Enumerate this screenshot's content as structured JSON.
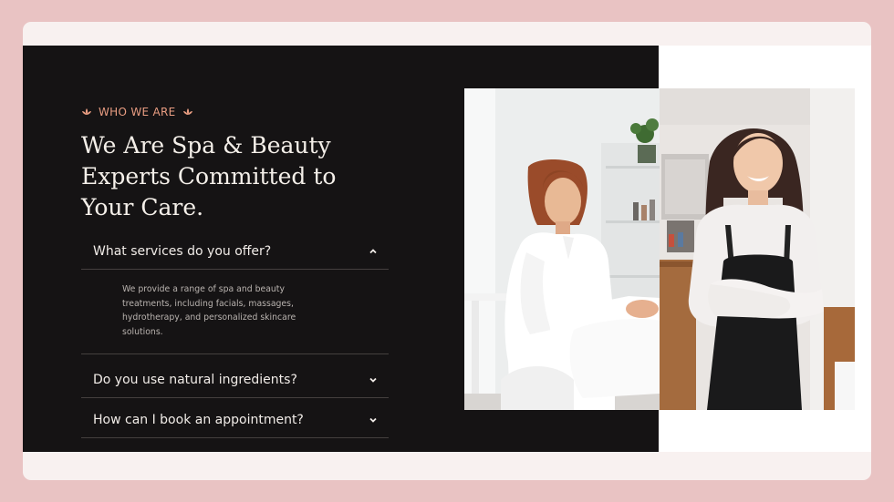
{
  "section": {
    "eyebrow": "WHO WE ARE",
    "title": "We Are Spa & Beauty Experts Committed to Your Care."
  },
  "faq": [
    {
      "question": "What services do you offer?",
      "answer": "We provide a range of spa and beauty treatments, including facials, massages, hydrotherapy, and personalized skincare solutions.",
      "expanded": true,
      "icon": "chevron-up-icon"
    },
    {
      "question": "Do you use natural ingredients?",
      "expanded": false,
      "icon": "chevron-down-icon"
    },
    {
      "question": "How can I book an appointment?",
      "expanded": false,
      "icon": "chevron-down-icon"
    }
  ],
  "images": [
    {
      "name": "photo-therapist-seated",
      "depicts": "woman in white uniform seated in spa room"
    },
    {
      "name": "photo-stylist-apron",
      "depicts": "smiling woman in black apron with crossed arms"
    }
  ],
  "colors": {
    "outer_background": "#e9c3c3",
    "panel_dark": "#151314",
    "accent": "#e99d82",
    "text_light": "#f4efe9"
  }
}
